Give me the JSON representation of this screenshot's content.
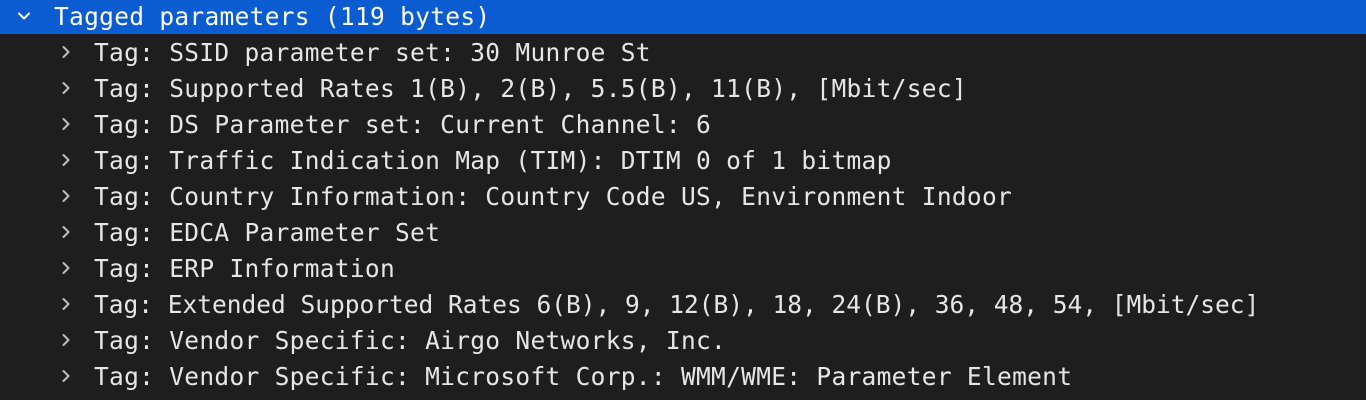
{
  "tree": {
    "parent": {
      "label": "Tagged parameters (119 bytes)",
      "icon": "chevron-down-icon",
      "expanded": true,
      "selected": true
    },
    "children": [
      {
        "label": "Tag: SSID parameter set: 30 Munroe St",
        "icon": "chevron-right-icon"
      },
      {
        "label": "Tag: Supported Rates 1(B), 2(B), 5.5(B), 11(B), [Mbit/sec]",
        "icon": "chevron-right-icon"
      },
      {
        "label": "Tag: DS Parameter set: Current Channel: 6",
        "icon": "chevron-right-icon"
      },
      {
        "label": "Tag: Traffic Indication Map (TIM): DTIM 0 of 1 bitmap",
        "icon": "chevron-right-icon"
      },
      {
        "label": "Tag: Country Information: Country Code US, Environment Indoor",
        "icon": "chevron-right-icon"
      },
      {
        "label": "Tag: EDCA Parameter Set",
        "icon": "chevron-right-icon"
      },
      {
        "label": "Tag: ERP Information",
        "icon": "chevron-right-icon"
      },
      {
        "label": "Tag: Extended Supported Rates 6(B), 9, 12(B), 18, 24(B), 36, 48, 54, [Mbit/sec]",
        "icon": "chevron-right-icon"
      },
      {
        "label": "Tag: Vendor Specific: Airgo Networks, Inc.",
        "icon": "chevron-right-icon"
      },
      {
        "label": "Tag: Vendor Specific: Microsoft Corp.: WMM/WME: Parameter Element",
        "icon": "chevron-right-icon"
      }
    ]
  },
  "colors": {
    "background": "#1e1e1e",
    "selection": "#0a5cd0",
    "text": "#e6e6e6",
    "chevron": "#bdbdbd"
  }
}
